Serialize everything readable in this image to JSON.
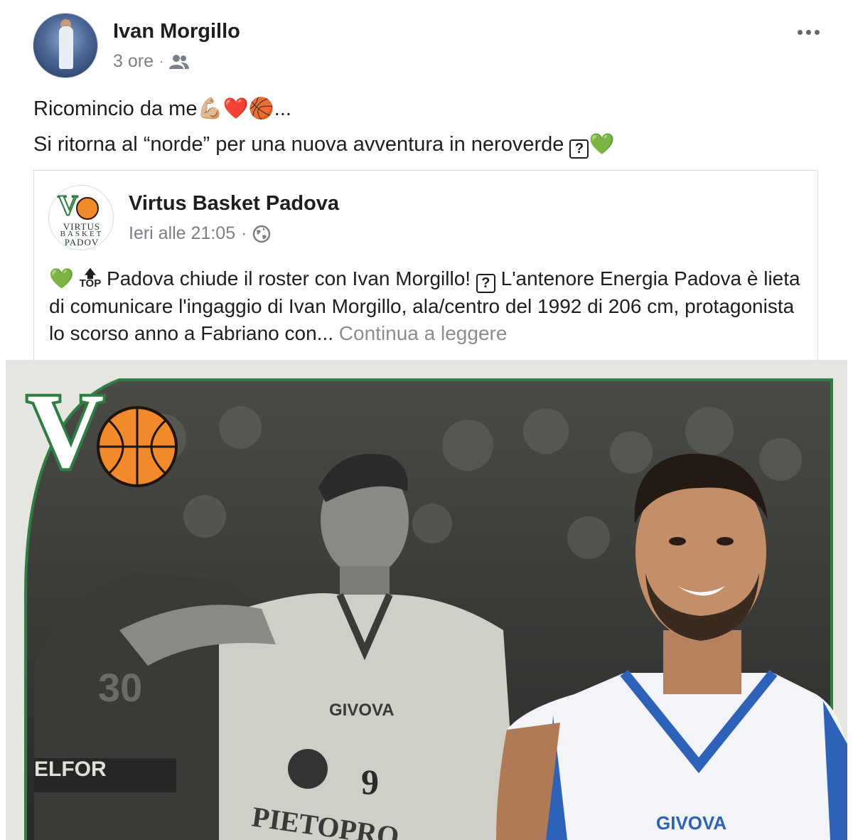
{
  "post": {
    "author": "Ivan Morgillo",
    "time": "3 ore",
    "audience_icon": "friends-icon",
    "more_icon": "more-options-icon",
    "line1": "Ricomincio da me💪🏼❤️🏀...",
    "line2_prefix": "Si ritorna al “norde” per una nuova avventura in neroverde ",
    "line2_box": "?",
    "line2_suffix": "💚"
  },
  "shared": {
    "page_name": "Virtus Basket Padova",
    "time": "Ieri alle 21:05",
    "audience_icon": "globe-icon",
    "logo_letter": "V",
    "logo_text_1": "VIRTUS",
    "logo_text_2": "BASKET",
    "logo_text_3": "PADOV",
    "text_emoji": "💚",
    "top_arrow": "🡅",
    "top_label": "TOP",
    "text_a": " Padova chiude il roster con Ivan Morgillo! ",
    "text_box": "?",
    "text_b": " L'antenore Energia Padova è lieta di comunicare l'ingaggio di Ivan Morgillo, ala/centro del 1992 di 206 cm, protagonista lo scorso anno a Fabriano con... ",
    "continue_label": "Continua a leggere"
  },
  "photo": {
    "logo_letter": "V",
    "left_jersey_brand": "GIVOVA",
    "left_jersey_number": "9",
    "left_jersey_sponsor": "PIETOPRO",
    "left_bg_text": "ELFOR",
    "left_bg_number": "30",
    "right_jersey_brand": "GIVOVA"
  }
}
